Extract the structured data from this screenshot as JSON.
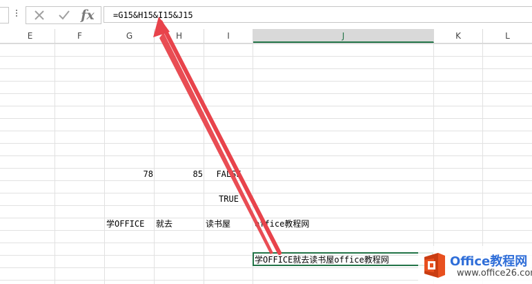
{
  "formula_bar": {
    "formula": "=G15&H15&I15&J15",
    "cancel_icon": "close-icon",
    "enter_icon": "check-icon",
    "fx_label": "fx"
  },
  "columns": [
    {
      "label": "E"
    },
    {
      "label": "F"
    },
    {
      "label": "G"
    },
    {
      "label": "H"
    },
    {
      "label": "I"
    },
    {
      "label": "J",
      "active": true
    },
    {
      "label": "K"
    },
    {
      "label": "L"
    }
  ],
  "cells": {
    "g11": "78",
    "h11": "85",
    "i11": "FALSE",
    "i13": "TRUE",
    "g15": "学OFFICE",
    "h15": "就去",
    "i15": "读书屋",
    "j15": "office教程网",
    "j17": "学OFFICE就去读书屋office教程网"
  },
  "watermark": {
    "title": "Office教程网",
    "url": "www.office26.com",
    "brand_color": "#2f6ed8",
    "logo_color": "#e8501f"
  },
  "colors": {
    "excel_green": "#217346",
    "arrow": "#e8434b"
  }
}
